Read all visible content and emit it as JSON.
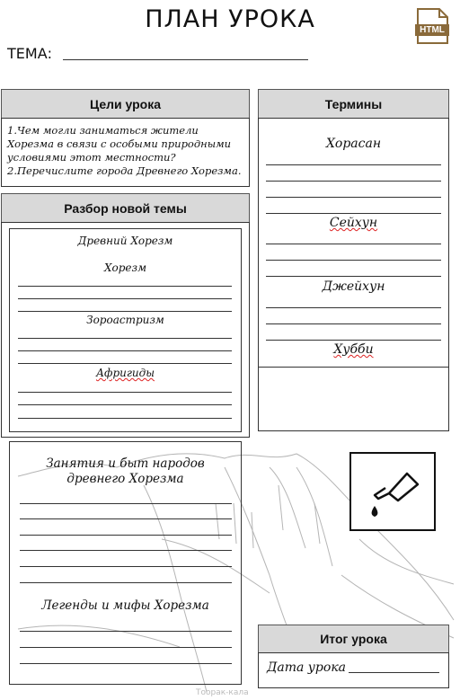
{
  "title": "ПЛАН УРОКА",
  "topic_label": "ТЕМА:",
  "badge": "HTML",
  "goals": {
    "header": "Цели урока",
    "text": "1.Чем могли заниматься жители Хорезма в связи с особыми природными условиями этот местности?\n2.Перечислите города Древнего Хорезма."
  },
  "terms": {
    "header": "Термины",
    "items": [
      "Хорасан",
      "Сейхун",
      "Джейхун",
      "Хубби"
    ]
  },
  "new_topic": {
    "header": "Разбор новой темы",
    "title": "Древний Хорезм",
    "items": [
      "Хорезм",
      "Зороастризм",
      "Афригиды"
    ]
  },
  "lower": {
    "heading1": "Занятия и быт народов\nдревнего Хорезма",
    "heading2": "Легенды и мифы Хорезма"
  },
  "summary": {
    "header": "Итог урока",
    "date_label": "Дата урока"
  },
  "watermark": "Тоорак-кала"
}
